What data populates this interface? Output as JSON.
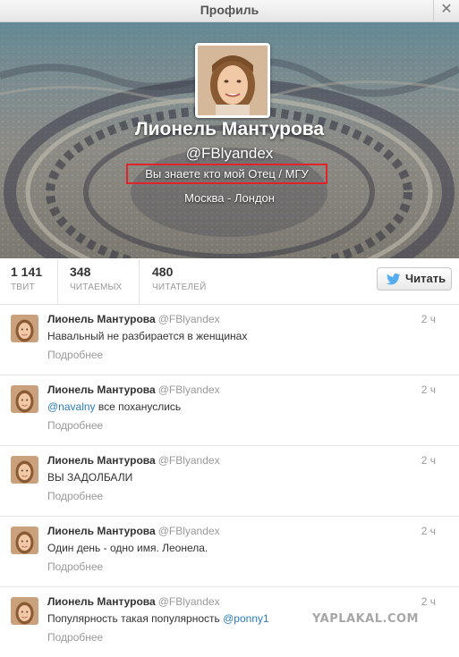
{
  "window": {
    "title": "Профиль",
    "close_glyph": "✕"
  },
  "profile": {
    "name": "Лионель Мантурова",
    "handle": "@FBlyandex",
    "bio": "Вы знаете кто мой Отец / МГУ",
    "location": "Москва - Лондон"
  },
  "stats": [
    {
      "value": "1 141",
      "label": "ТВИТ"
    },
    {
      "value": "348",
      "label": "ЧИТАЕМЫХ"
    },
    {
      "value": "480",
      "label": "ЧИТАТЕЛЕЙ"
    }
  ],
  "follow_button": {
    "label": "Читать",
    "icon": "twitter-bird-icon"
  },
  "tweets": [
    {
      "author": "Лионель Мантурова",
      "username": "@FBlyandex",
      "time": "2 ч",
      "text": "Навальный не разбирается в женщинах",
      "mention": "",
      "text_after": "",
      "more": "Подробнее"
    },
    {
      "author": "Лионель Мантурова",
      "username": "@FBlyandex",
      "time": "2 ч",
      "text": "",
      "mention": "@navalny",
      "text_after": " все похануслись",
      "more": "Подробнее"
    },
    {
      "author": "Лионель Мантурова",
      "username": "@FBlyandex",
      "time": "2 ч",
      "text": "ВЫ ЗАДОЛБАЛИ",
      "mention": "",
      "text_after": "",
      "more": "Подробнее"
    },
    {
      "author": "Лионель Мантурова",
      "username": "@FBlyandex",
      "time": "2 ч",
      "text": "Один день - одно имя. Леонела.",
      "mention": "",
      "text_after": "",
      "more": "Подробнее"
    },
    {
      "author": "Лионель Мантурова",
      "username": "@FBlyandex",
      "time": "2 ч",
      "text": "Популярность такая популярность ",
      "mention": "@ponny1",
      "text_after": "",
      "more": "Подробнее"
    }
  ],
  "watermark": "YAPLAKAL.COM",
  "colors": {
    "accent_link": "#2b7bb9",
    "highlight_border": "#e0242a",
    "twitter_blue": "#55acee"
  }
}
